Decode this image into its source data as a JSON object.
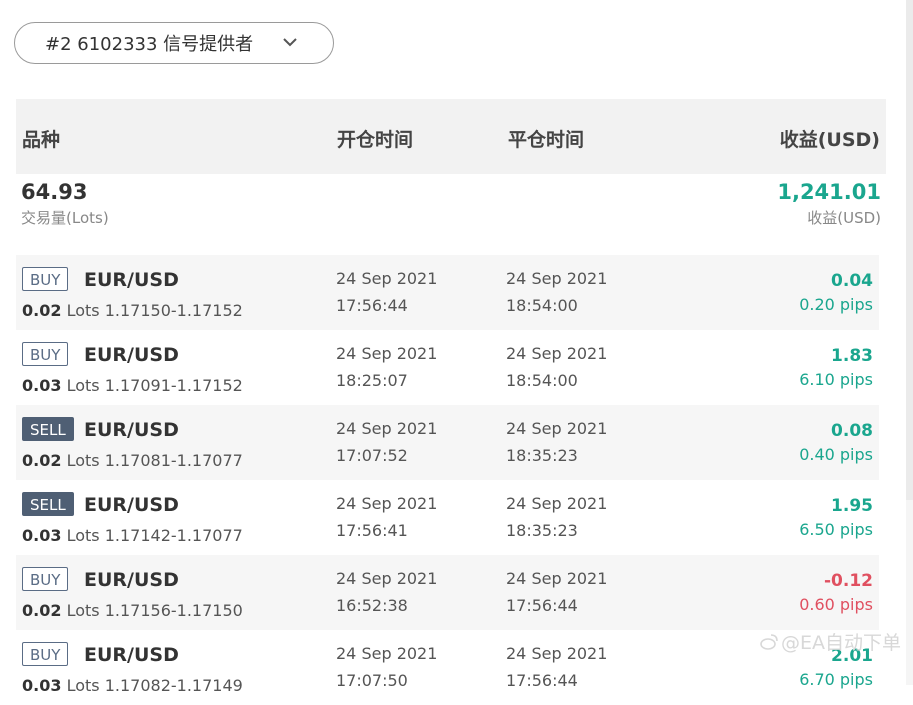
{
  "selector": {
    "label": "#2 6102333 信号提供者"
  },
  "header": {
    "symbol": "品种",
    "open_time": "开仓时间",
    "close_time": "平仓时间",
    "profit": "收益(USD)"
  },
  "summary": {
    "volume": "64.93",
    "volume_label": "交易量(Lots)",
    "profit": "1,241.01",
    "profit_label": "收益(USD)"
  },
  "trades": [
    {
      "type": "BUY",
      "pair": "EUR/USD",
      "lots": "0.02",
      "lots_word": "Lots",
      "prices": "1.17150-1.17152",
      "open_date": "24 Sep 2021",
      "open_time": "17:56:44",
      "close_date": "24 Sep 2021",
      "close_time": "18:54:00",
      "profit": "0.04",
      "pips": "0.20 pips"
    },
    {
      "type": "BUY",
      "pair": "EUR/USD",
      "lots": "0.03",
      "lots_word": "Lots",
      "prices": "1.17091-1.17152",
      "open_date": "24 Sep 2021",
      "open_time": "18:25:07",
      "close_date": "24 Sep 2021",
      "close_time": "18:54:00",
      "profit": "1.83",
      "pips": "6.10 pips"
    },
    {
      "type": "SELL",
      "pair": "EUR/USD",
      "lots": "0.02",
      "lots_word": "Lots",
      "prices": "1.17081-1.17077",
      "open_date": "24 Sep 2021",
      "open_time": "17:07:52",
      "close_date": "24 Sep 2021",
      "close_time": "18:35:23",
      "profit": "0.08",
      "pips": "0.40 pips"
    },
    {
      "type": "SELL",
      "pair": "EUR/USD",
      "lots": "0.03",
      "lots_word": "Lots",
      "prices": "1.17142-1.17077",
      "open_date": "24 Sep 2021",
      "open_time": "17:56:41",
      "close_date": "24 Sep 2021",
      "close_time": "18:35:23",
      "profit": "1.95",
      "pips": "6.50 pips"
    },
    {
      "type": "BUY",
      "pair": "EUR/USD",
      "lots": "0.02",
      "lots_word": "Lots",
      "prices": "1.17156-1.17150",
      "open_date": "24 Sep 2021",
      "open_time": "16:52:38",
      "close_date": "24 Sep 2021",
      "close_time": "17:56:44",
      "profit": "-0.12",
      "pips": "0.60 pips"
    },
    {
      "type": "BUY",
      "pair": "EUR/USD",
      "lots": "0.03",
      "lots_word": "Lots",
      "prices": "1.17082-1.17149",
      "open_date": "24 Sep 2021",
      "open_time": "17:07:50",
      "close_date": "24 Sep 2021",
      "close_time": "17:56:44",
      "profit": "2.01",
      "pips": "6.70 pips"
    }
  ],
  "watermark": {
    "text": "@EA自动下单",
    "icon": "weibo-icon"
  },
  "colors": {
    "positive": "#1aa68e",
    "negative": "#e05060",
    "sell_badge": "#4f5f74",
    "buy_badge_border": "#5a6c85",
    "header_bg": "#f2f2f2",
    "alt_row_bg": "#f6f6f6"
  }
}
